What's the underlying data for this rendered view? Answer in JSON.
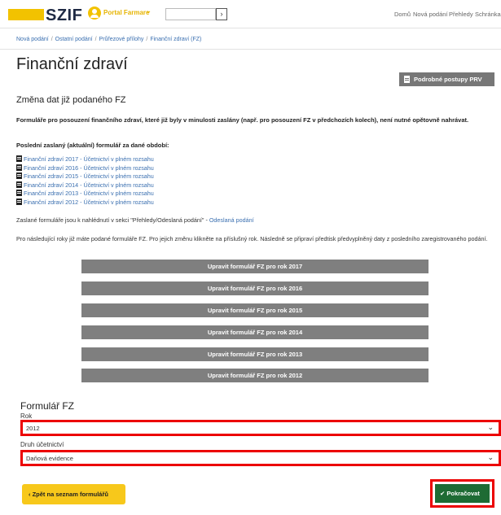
{
  "header": {
    "logo_text": "SZIF",
    "portal_label": "Portal Farmare",
    "portal_chevron": "⌄",
    "search_value": "",
    "search_go": "›",
    "nav": [
      "Domů",
      "Nová podání",
      "Přehledy",
      "Schránka"
    ]
  },
  "breadcrumb": [
    "Nová podání",
    "Ostatní podání",
    "Průřezové přílohy",
    "Finanční zdraví (FZ)"
  ],
  "page_title": "Finanční zdraví",
  "guide_button": "Podrobné postupy PRV",
  "subhead": "Změna dat již podaného FZ",
  "lead": "Formuláře pro posouzení finančního zdraví, které již byly v minulosti zaslány (např. pro posouzení FZ v předchozích kolech), není nutné opětovně nahrávat.",
  "latest_label": "Poslední zaslaný (aktuální) formulář za dané období:",
  "fz_links": [
    "Finanční zdraví 2017 - Účetnictví v plném rozsahu",
    "Finanční zdraví 2016 - Účetnictví v plném rozsahu",
    "Finanční zdraví 2015 - Účetnictví v plném rozsahu",
    "Finanční zdraví 2014 - Účetnictví v plném rozsahu",
    "Finanční zdraví 2013 - Účetnictví v plném rozsahu",
    "Finanční zdraví 2012 - Účetnictví v plném rozsahu"
  ],
  "sent_note": "Zaslané formuláře jsou k nahlédnutí v sekci \"Přehledy/Odeslaná podání\" - ",
  "sent_link": "Odeslaná podání",
  "info_para": "Pro následující roky již máte podané formuláře FZ. Pro jejich změnu klikněte na příslušný rok. Následně se připraví předtisk předvyplněný daty z posledního zaregistrovaného podání.",
  "edit_buttons": [
    "Upravit formulář FZ pro rok 2017",
    "Upravit formulář FZ pro rok 2016",
    "Upravit formulář FZ pro rok 2015",
    "Upravit formulář FZ pro rok 2014",
    "Upravit formulář FZ pro rok 2013",
    "Upravit formulář FZ pro rok 2012"
  ],
  "form": {
    "heading": "Formulář FZ",
    "year_label": "Rok",
    "year_value": "2012",
    "accounting_label": "Druh účetnictví",
    "accounting_value": "Daňová evidence",
    "caret": "⌄"
  },
  "back_button": "Zpět na seznam formulářů",
  "continue_button": "Pokračovat",
  "colors": {
    "brand_yellow": "#f2c200",
    "link_blue": "#3a6fb0",
    "button_grey": "#7f7f7f",
    "highlight_red": "#ec0000",
    "continue_green": "#1e6b34"
  }
}
